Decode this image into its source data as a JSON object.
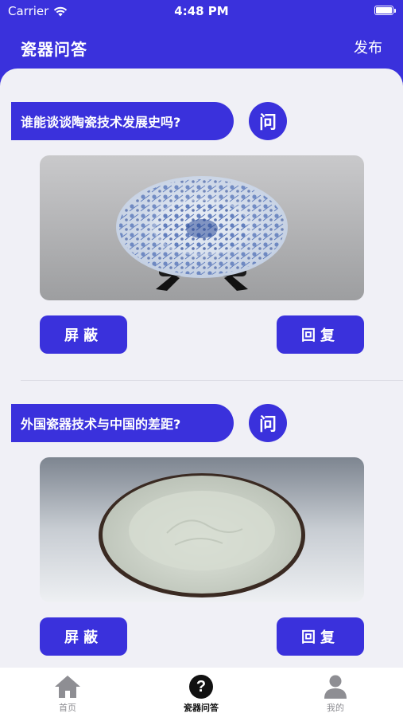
{
  "status_bar": {
    "carrier": "Carrier",
    "time": "4:48 PM"
  },
  "header": {
    "title": "瓷器问答",
    "publish": "发布"
  },
  "questions": [
    {
      "text": "谁能谈谈陶瓷技术发展史吗?",
      "ask_label": "问",
      "block_label": "屏蔽",
      "reply_label": "回复",
      "image": "blue-and-white-porcelain-plate"
    },
    {
      "text": "外国瓷器技术与中国的差距?",
      "ask_label": "问",
      "block_label": "屏蔽",
      "reply_label": "回复",
      "image": "celadon-white-porcelain-dish"
    }
  ],
  "tabbar": {
    "items": [
      {
        "label": "首页",
        "icon": "home-icon"
      },
      {
        "label": "瓷器问答",
        "icon": "question-icon",
        "active": true
      },
      {
        "label": "我的",
        "icon": "person-icon"
      }
    ]
  },
  "colors": {
    "accent": "#3a31dc",
    "background": "#f0f0f6"
  }
}
